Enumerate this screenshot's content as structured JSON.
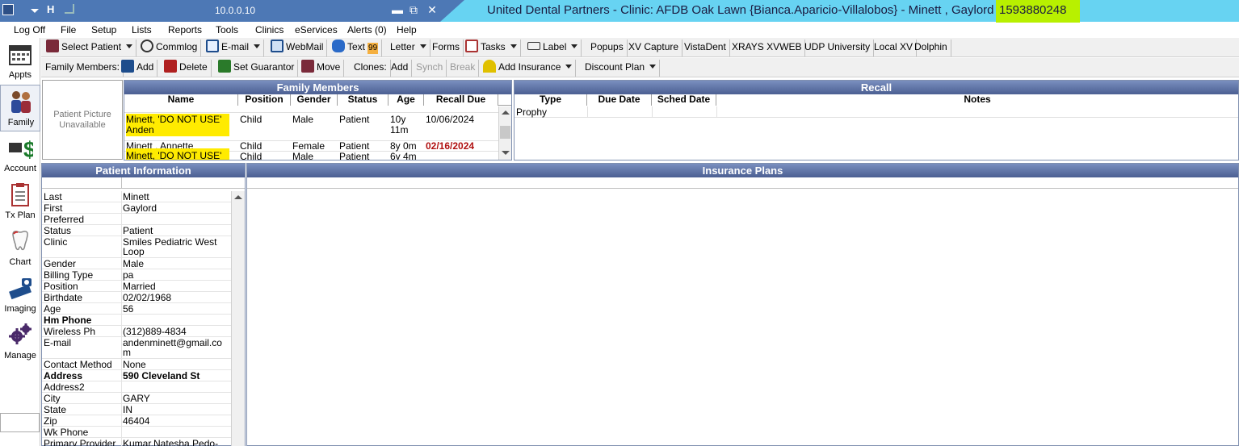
{
  "titlebar": {
    "server": "10.0.0.10",
    "title": "United Dental Partners - Clinic: AFDB Oak Lawn {Bianca.Aparicio-Villalobos} - Minett , Gaylord - ",
    "patient_phone": "1593880248",
    "minimize": "▬",
    "restore": "⧉",
    "close": "✕"
  },
  "menu": [
    "Log Off",
    "File",
    "Setup",
    "Lists",
    "Reports",
    "Tools",
    "Clinics",
    "eServices",
    "Alerts (0)",
    "Help"
  ],
  "sidebar": [
    {
      "label": "Appts",
      "icon": "calendar-icon"
    },
    {
      "label": "Family",
      "icon": "family-icon"
    },
    {
      "label": "Account",
      "icon": "dollar-icon"
    },
    {
      "label": "Tx Plan",
      "icon": "clipboard-icon"
    },
    {
      "label": "Chart",
      "icon": "tooth-icon"
    },
    {
      "label": "Imaging",
      "icon": "scanner-icon"
    },
    {
      "label": "Manage",
      "icon": "gears-icon"
    }
  ],
  "toolbar1": [
    {
      "label": "Select Patient",
      "dropdown": true
    },
    {
      "label": "Commlog"
    },
    {
      "label": "E-mail",
      "dropdown": true
    },
    {
      "label": "WebMail"
    },
    {
      "label": "Text",
      "badge": "99"
    },
    {
      "label": "Letter",
      "dropdown": true
    },
    {
      "label": "Forms"
    },
    {
      "label": "Tasks",
      "dropdown": true
    },
    {
      "label": "Label",
      "dropdown": true
    },
    {
      "label": "Popups"
    },
    {
      "label": "XV Capture"
    },
    {
      "label": "VistaDent"
    },
    {
      "label": "XRAYS XVWEB"
    },
    {
      "label": "UDP University"
    },
    {
      "label": "Local XV"
    },
    {
      "label": "Dolphin"
    }
  ],
  "toolbar2": {
    "family_members_label": "Family Members:",
    "add": "Add",
    "delete": "Delete",
    "set_guarantor": "Set Guarantor",
    "move": "Move",
    "clones_label": "Clones:",
    "clone_add": "Add",
    "synch": "Synch",
    "break": "Break",
    "add_insurance": "Add Insurance",
    "discount_plan": "Discount Plan"
  },
  "picture": {
    "text": "Patient Picture Unavailable"
  },
  "family": {
    "title": "Family Members",
    "columns": [
      "Name",
      "Position",
      "Gender",
      "Status",
      "Age",
      "Recall Due"
    ],
    "rows": [
      {
        "name": "Minett, 'DO NOT USE' Anden",
        "position": "Child",
        "gender": "Male",
        "status": "Patient",
        "age": "10y 11m",
        "recall": "10/06/2024",
        "highlight": true,
        "overdue": false
      },
      {
        "name": "Minett , Annette",
        "position": "Child",
        "gender": "Female",
        "status": "Patient",
        "age": "8y 0m",
        "recall": "02/16/2024",
        "highlight": false,
        "overdue": true
      },
      {
        "name": "Minett, 'DO NOT USE'",
        "position": "Child",
        "gender": "Male",
        "status": "Patient",
        "age": "6y 4m",
        "recall": "",
        "highlight": true,
        "overdue": false
      }
    ]
  },
  "recall": {
    "title": "Recall",
    "columns": [
      "Type",
      "Due Date",
      "Sched Date",
      "Notes"
    ],
    "rows": [
      {
        "type": "Prophy",
        "due": "",
        "sched": "",
        "notes": ""
      }
    ]
  },
  "patient_info": {
    "title": "Patient Information",
    "rows": [
      {
        "label": "Last",
        "value": "Minett",
        "bold": false
      },
      {
        "label": "First",
        "value": "Gaylord",
        "bold": false
      },
      {
        "label": "Preferred",
        "value": "",
        "bold": false
      },
      {
        "label": "Status",
        "value": "Patient",
        "bold": false
      },
      {
        "label": "Clinic",
        "value": "Smiles Pediatric West Loop",
        "bold": false
      },
      {
        "label": "Gender",
        "value": "Male",
        "bold": false
      },
      {
        "label": "Billing Type",
        "value": "pa",
        "bold": false
      },
      {
        "label": "Position",
        "value": "Married",
        "bold": false
      },
      {
        "label": "Birthdate",
        "value": "02/02/1968",
        "bold": false
      },
      {
        "label": "Age",
        "value": "56",
        "bold": false
      },
      {
        "label": "Hm Phone",
        "value": "",
        "bold": true
      },
      {
        "label": "Wireless Ph",
        "value": "(312)889-4834",
        "bold": false
      },
      {
        "label": "E-mail",
        "value": "andenminett@gmail.com",
        "bold": false
      },
      {
        "label": "Contact Method",
        "value": "None",
        "bold": false
      },
      {
        "label": "Address",
        "value": "590 Cleveland St",
        "bold": true
      },
      {
        "label": "Address2",
        "value": "",
        "bold": false
      },
      {
        "label": "City",
        "value": "GARY",
        "bold": false
      },
      {
        "label": "State",
        "value": "IN",
        "bold": false
      },
      {
        "label": "Zip",
        "value": "46404",
        "bold": false
      },
      {
        "label": "Wk Phone",
        "value": "",
        "bold": false
      },
      {
        "label": "Primary Provider",
        "value": "Kumar.Natesha.Pedo-",
        "bold": false
      }
    ]
  },
  "insurance": {
    "title": "Insurance Plans"
  },
  "colors": {
    "title_bg": "#67d3f2",
    "title_dark": "#4d78b5",
    "phone_highlight": "#b8f000",
    "row_highlight": "#ffeb00",
    "header_gradient_top": "#7a8fbf",
    "overdue_red": "#b01010"
  }
}
